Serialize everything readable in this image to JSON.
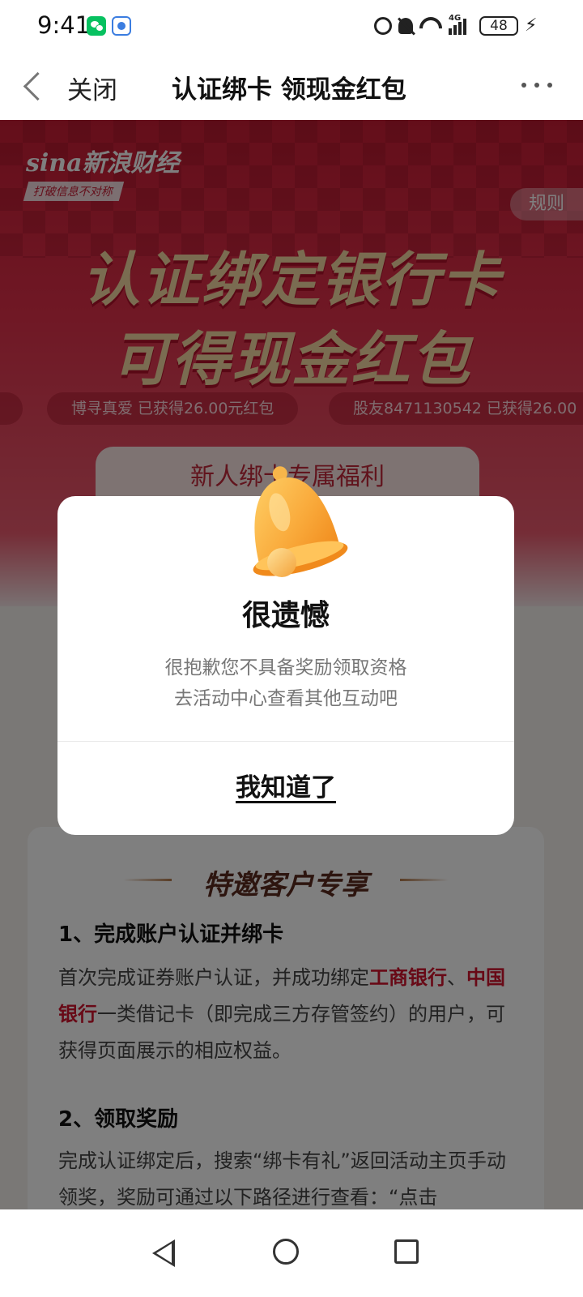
{
  "status_bar": {
    "time": "9:41",
    "network": "4G",
    "battery": "48",
    "icons": [
      "wechat-icon",
      "shield-icon",
      "alarm-icon",
      "bell-off-icon",
      "wifi-icon",
      "signal-icon",
      "battery-icon",
      "charge-icon"
    ]
  },
  "nav": {
    "close_label": "关闭",
    "title": "认证绑卡 领现金红包"
  },
  "banner": {
    "logo_text": "sina新浪财经",
    "logo_slogan": "打破信息不对称",
    "rules_label": "规则",
    "hero_line1": "认证绑定银行卡",
    "hero_line2": "可得现金红包",
    "tickers": [
      "博寻真爱 已获得26.00元红包",
      "股友8471130542 已获得26.00"
    ],
    "tab_label": "新人绑卡专属福利"
  },
  "info": {
    "section_title": "特邀客户专享",
    "step1_title": "1、完成账户认证并绑卡",
    "step1_body_a": "首次完成证券账户认证，并成功绑定",
    "bank1": "工商银行",
    "sep": "、",
    "bank2": "中国银行",
    "step1_body_b": "一类借记卡（即完成三方存管签约）的用户，可获得页面展示的相应权益。",
    "step2_title": "2、领取奖励",
    "step2_body": "完成认证绑定后，搜索“绑卡有礼”返回活动主页手动领奖，奖励可通过以下路径进行查看：“点击"
  },
  "dialog": {
    "title": "很遗憾",
    "message_line1": "很抱歉您不具备奖励领取资格",
    "message_line2": "去活动中心查看其他互动吧",
    "confirm_label": "我知道了"
  },
  "colors": {
    "brand_red": "#c91d35",
    "highlight_red": "#d0122c",
    "bell_orange": "#f7a839"
  }
}
